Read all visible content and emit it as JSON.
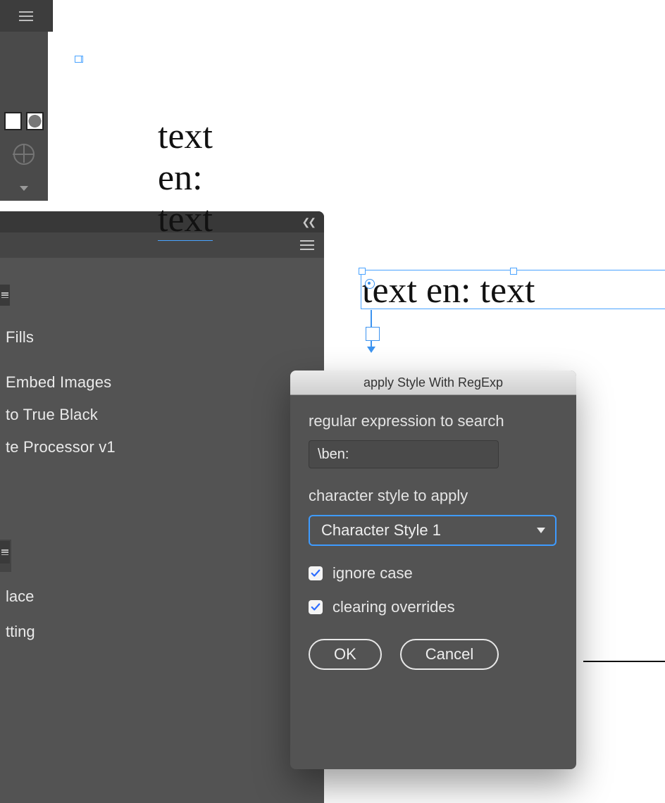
{
  "canvas": {
    "text1": "text en: text",
    "text2": "text en: text"
  },
  "scripts_panel": {
    "items": [
      "Fills",
      "Embed Images",
      "to True Black",
      "te Processor v1"
    ],
    "items2": [
      "lace",
      "tting"
    ]
  },
  "dialog": {
    "title": "apply Style With RegExp",
    "regex_label": "regular expression to search",
    "regex_value": "\\ben:",
    "style_label": "character style to apply",
    "style_selected": "Character Style 1",
    "ignore_case_label": "ignore case",
    "ignore_case_checked": true,
    "clear_overrides_label": "clearing overrides",
    "clear_overrides_checked": true,
    "ok_label": "OK",
    "cancel_label": "Cancel"
  }
}
